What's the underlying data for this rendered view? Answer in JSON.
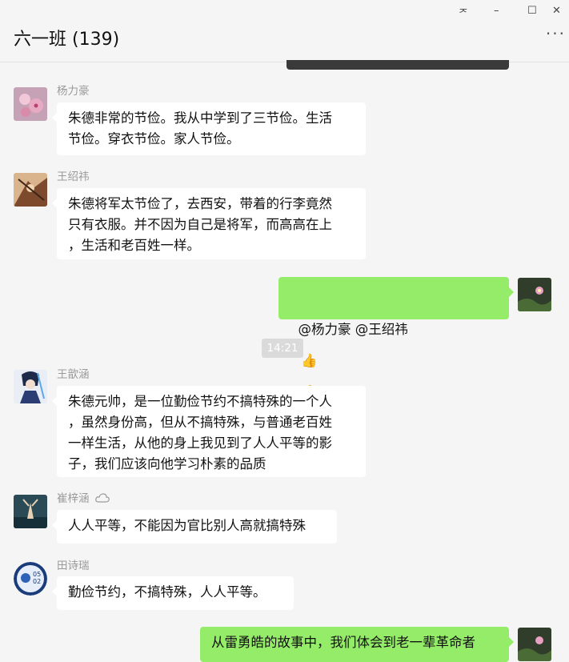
{
  "window": {
    "title": "六一班 (139)",
    "controls": {
      "pin": "ᅎ",
      "minimize": "–",
      "maximize": "☐",
      "close": "✕"
    },
    "more": "···"
  },
  "time_divider": "14:21",
  "messages": [
    {
      "sender": "杨力豪",
      "text": "朱德非常的节俭。我从中学到了三节俭。生活\n节俭。穿衣节俭。家人节俭。"
    },
    {
      "sender": "王绍祎",
      "text": "朱德将军太节俭了，去西安，带着的行李竟然\n只有衣服。并不因为自己是将军，而高高在上\n，生活和老百姓一样。"
    },
    {
      "sender": "me",
      "text": "@杨力豪 @王绍祎",
      "emoji": [
        "👍",
        "👍",
        "👍"
      ]
    },
    {
      "sender": "王歆涵",
      "text": "朱德元帅，是一位勤俭节约不搞特殊的一个人\n，虽然身份高，但从不搞特殊，与普通老百姓\n一样生活，从他的身上我见到了人人平等的影\n子，我们应该向他学习朴素的品质"
    },
    {
      "sender": "崔梓涵",
      "text": "人人平等，不能因为官比别人高就搞特殊"
    },
    {
      "sender": "田诗瑞",
      "text": "勤俭节约，不搞特殊，人人平等。"
    },
    {
      "sender": "me",
      "text": "从雷勇皓的故事中，我们体会到老一辈革命者"
    }
  ],
  "avatar_badge": "05\n02",
  "colors": {
    "my_bubble": "#95ec69",
    "their_bubble": "#ffffff",
    "background": "#f5f5f5"
  }
}
